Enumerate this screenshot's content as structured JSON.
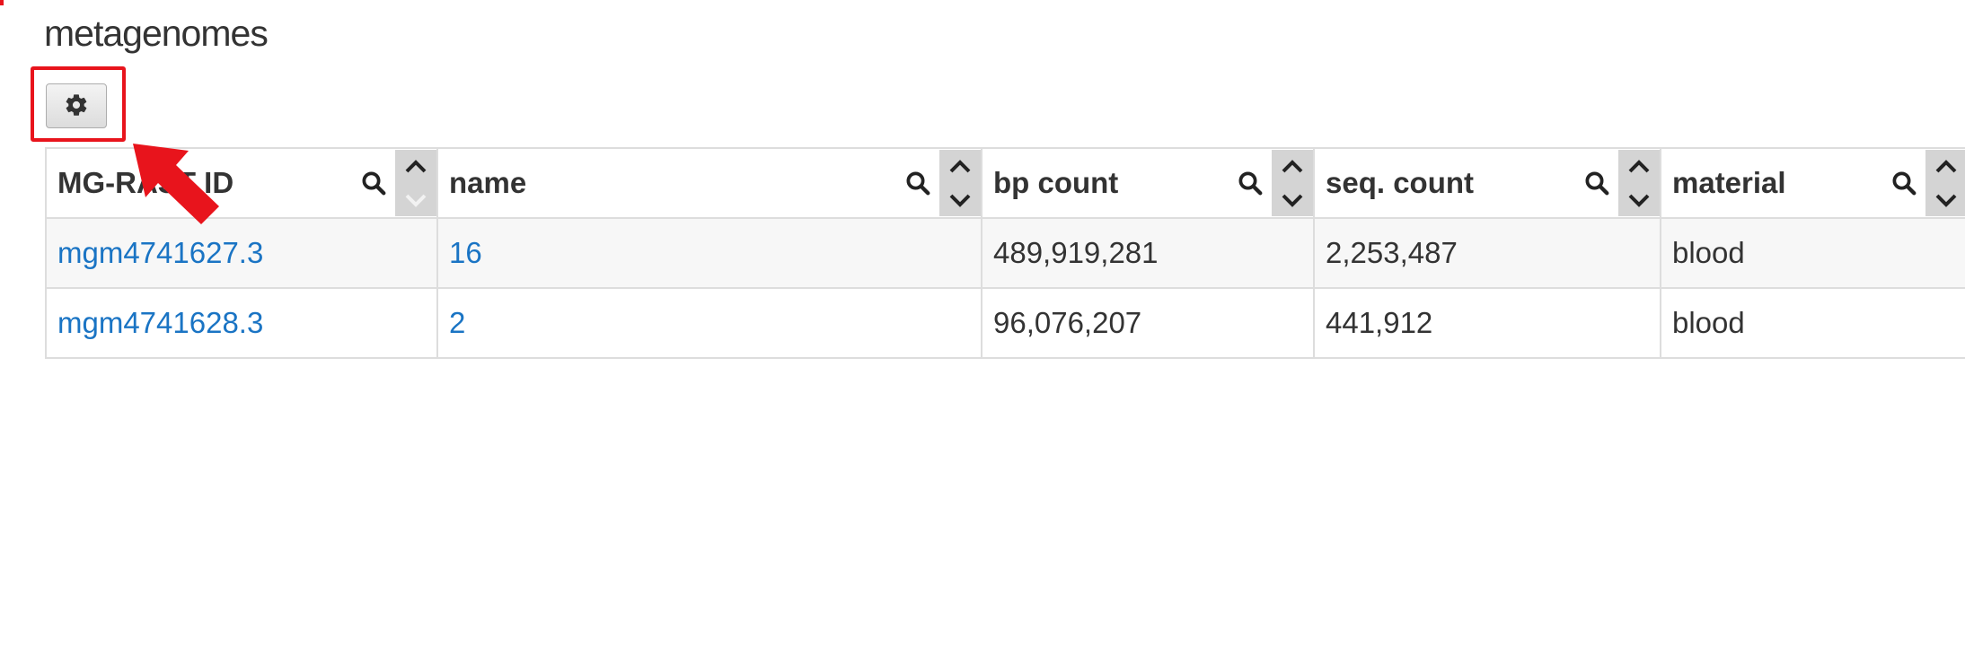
{
  "page": {
    "title": "metagenomes"
  },
  "toolbar": {
    "settings_icon": "gear-icon"
  },
  "table": {
    "columns": [
      {
        "key": "id",
        "label": "MG-RAST ID"
      },
      {
        "key": "name",
        "label": "name"
      },
      {
        "key": "bp_count",
        "label": "bp count"
      },
      {
        "key": "seq_count",
        "label": "seq. count"
      },
      {
        "key": "material",
        "label": "material"
      }
    ],
    "rows": [
      {
        "id": "mgm4741627.3",
        "name": "16",
        "bp_count": "489,919,281",
        "seq_count": "2,253,487",
        "material": "blood"
      },
      {
        "id": "mgm4741628.3",
        "name": "2",
        "bp_count": "96,076,207",
        "seq_count": "441,912",
        "material": "blood"
      }
    ]
  },
  "colors": {
    "link": "#1a74c4",
    "highlight": "#e8141c",
    "header_sort_bg": "#d4d4d4"
  }
}
